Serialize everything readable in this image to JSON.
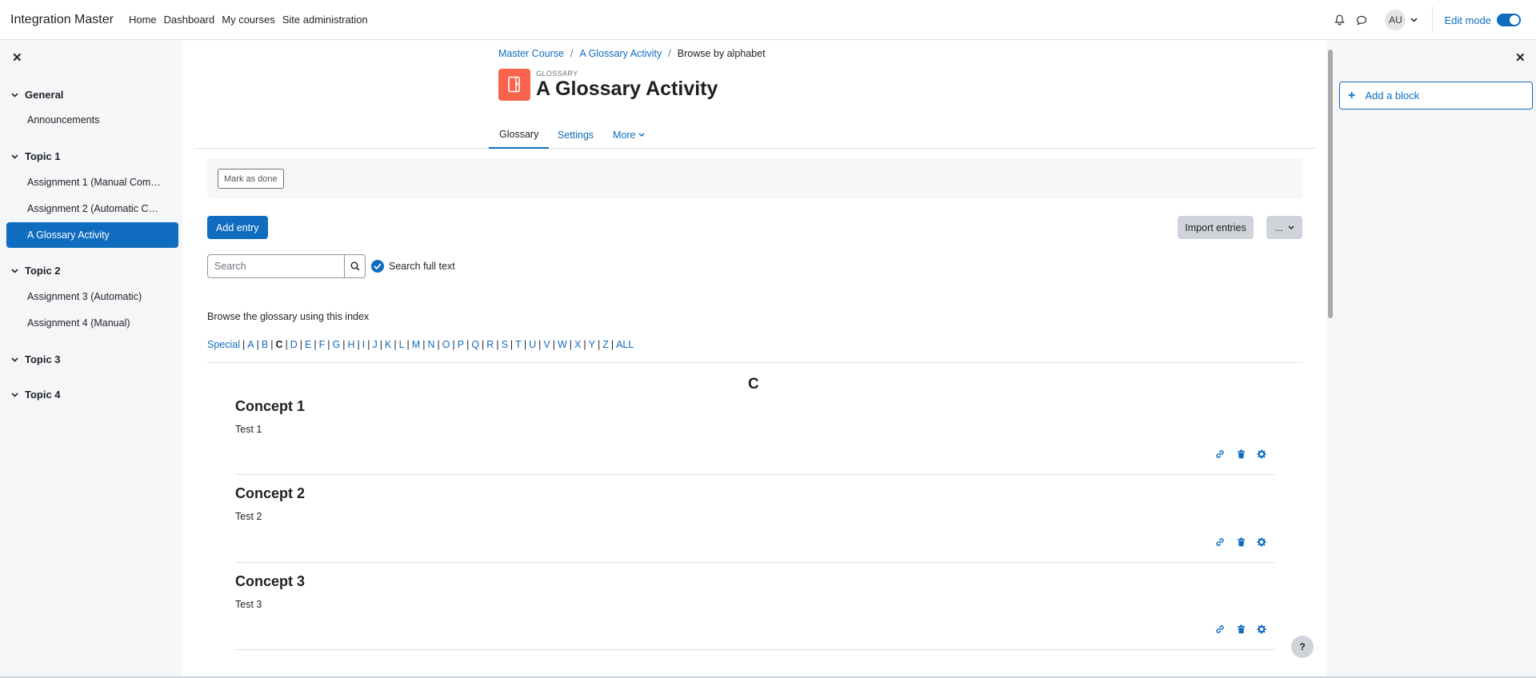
{
  "navbar": {
    "brand": "Integration Master",
    "links": [
      "Home",
      "Dashboard",
      "My courses",
      "Site administration"
    ],
    "avatar_initials": "AU",
    "edit_mode_label": "Edit mode"
  },
  "left_drawer": {
    "sections": [
      {
        "title": "General",
        "items": [
          "Announcements"
        ]
      },
      {
        "title": "Topic 1",
        "items": [
          "Assignment 1 (Manual Com…",
          "Assignment 2 (Automatic C…",
          "A Glossary Activity"
        ]
      },
      {
        "title": "Topic 2",
        "items": [
          "Assignment 3 (Automatic)",
          "Assignment 4 (Manual)"
        ]
      },
      {
        "title": "Topic 3",
        "items": []
      },
      {
        "title": "Topic 4",
        "items": []
      }
    ]
  },
  "right_drawer": {
    "add_block_label": "Add a block"
  },
  "breadcrumb": [
    "Master Course",
    "A Glossary Activity",
    "Browse by alphabet"
  ],
  "activity": {
    "type_label": "GLOSSARY",
    "title": "A Glossary Activity"
  },
  "tabs": [
    "Glossary",
    "Settings",
    "More"
  ],
  "completion": {
    "mark_done_label": "Mark as done"
  },
  "actions": {
    "add_entry_label": "Add entry",
    "import_entries_label": "Import entries",
    "more_label": "..."
  },
  "search": {
    "placeholder": "Search",
    "full_text_label": "Search full text"
  },
  "browse": {
    "intro": "Browse the glossary using this index",
    "letters": [
      "Special",
      "A",
      "B",
      "C",
      "D",
      "E",
      "F",
      "G",
      "H",
      "I",
      "J",
      "K",
      "L",
      "M",
      "N",
      "O",
      "P",
      "Q",
      "R",
      "S",
      "T",
      "U",
      "V",
      "W",
      "X",
      "Y",
      "Z",
      "ALL"
    ],
    "current_letter": "C",
    "section_heading": "C"
  },
  "entries": [
    {
      "concept": "Concept 1",
      "definition": "Test 1"
    },
    {
      "concept": "Concept 2",
      "definition": "Test 2"
    },
    {
      "concept": "Concept 3",
      "definition": "Test 3"
    }
  ],
  "help_label": "?",
  "colors": {
    "primary": "#0f6cbf",
    "activity_icon_bg": "#f7634d",
    "drawer_bg": "#f5f6f8"
  }
}
